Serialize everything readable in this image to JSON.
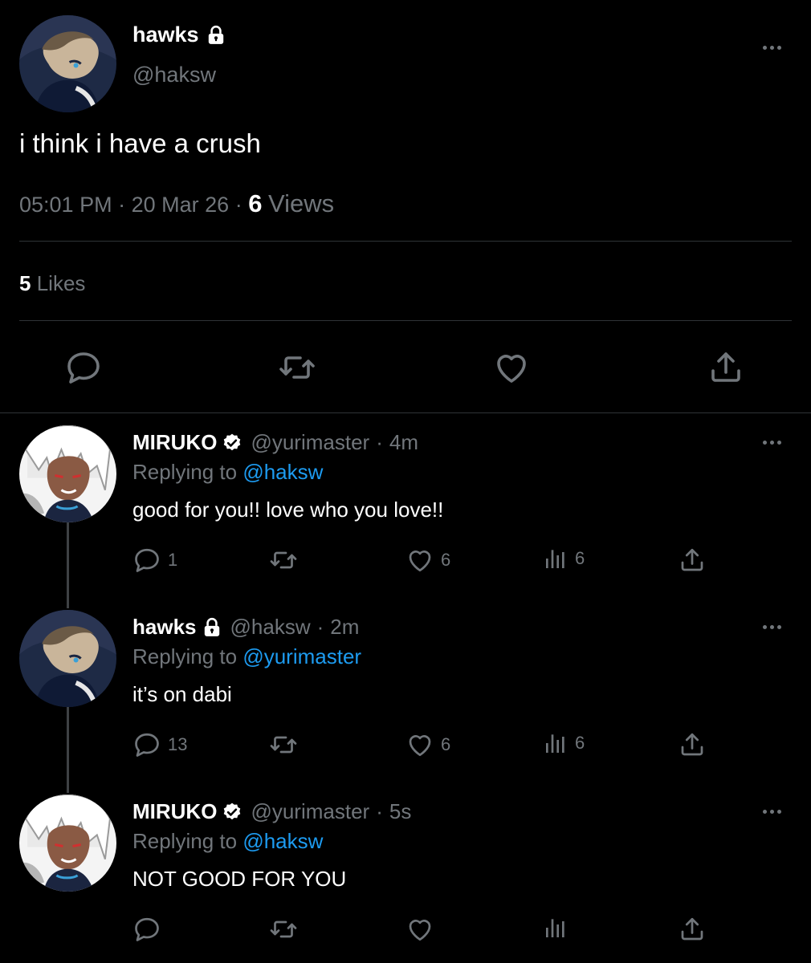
{
  "main_tweet": {
    "author_name": "hawks",
    "author_handle": "@haksw",
    "text": "i think i have a crush",
    "time": "05:01 PM",
    "date": "20 Mar 26",
    "views_count": "6",
    "views_label": "Views",
    "likes_count": "5",
    "likes_label": "Likes",
    "icons": [
      "reply-icon",
      "retweet-icon",
      "like-icon",
      "share-icon"
    ]
  },
  "replies": [
    {
      "name": "MIRUKO",
      "badge": "verified-icon",
      "handle": "@yurimaster",
      "time": "4m",
      "replying_label": "Replying to",
      "replying_to": "@haksw",
      "text": "good for you!! love who you love!!",
      "reply_count": "1",
      "retweet_count": "",
      "like_count": "6",
      "view_count": "6"
    },
    {
      "name": "hawks",
      "badge": "lock-icon",
      "handle": "@haksw",
      "time": "2m",
      "replying_label": "Replying to",
      "replying_to": "@yurimaster",
      "text": "it’s on dabi",
      "reply_count": "13",
      "retweet_count": "",
      "like_count": "6",
      "view_count": "6"
    },
    {
      "name": "MIRUKO",
      "badge": "verified-icon",
      "handle": "@yurimaster",
      "time": "5s",
      "replying_label": "Replying to",
      "replying_to": "@haksw",
      "text": "NOT GOOD FOR YOU",
      "reply_count": "",
      "retweet_count": "",
      "like_count": "",
      "view_count": ""
    }
  ],
  "separator": "·",
  "colors": {
    "background": "#000000",
    "text": "#e7e9ea",
    "secondary": "#71767b",
    "link": "#1d9bf0",
    "divider": "#2f3336"
  }
}
